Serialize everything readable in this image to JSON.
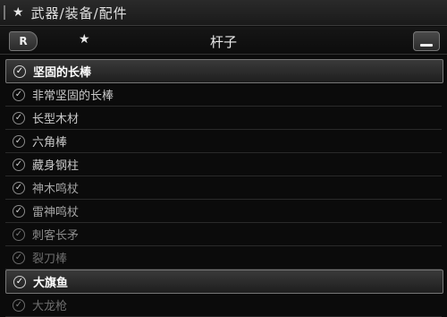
{
  "topbar": {
    "star_icon": "star-icon",
    "breadcrumb": "武器/装备/配件"
  },
  "category_bar": {
    "r_button": "R",
    "star_icon": "star-icon",
    "title": "杆子",
    "menu_icon": "menu-icon"
  },
  "list": {
    "groups": [
      {
        "header": "坚固的长棒",
        "items": [
          "非常坚固的长棒",
          "长型木材",
          "六角棒",
          "藏身钢柱",
          "神木鸣杖",
          "雷神鸣杖",
          "刺客长矛",
          "裂刀棒"
        ]
      },
      {
        "header": "大旗鱼",
        "items": [
          "大龙枪"
        ]
      }
    ]
  },
  "colors": {
    "background": "#0b0b0b",
    "header_border": "#777777",
    "text": "#d8d8d8"
  }
}
